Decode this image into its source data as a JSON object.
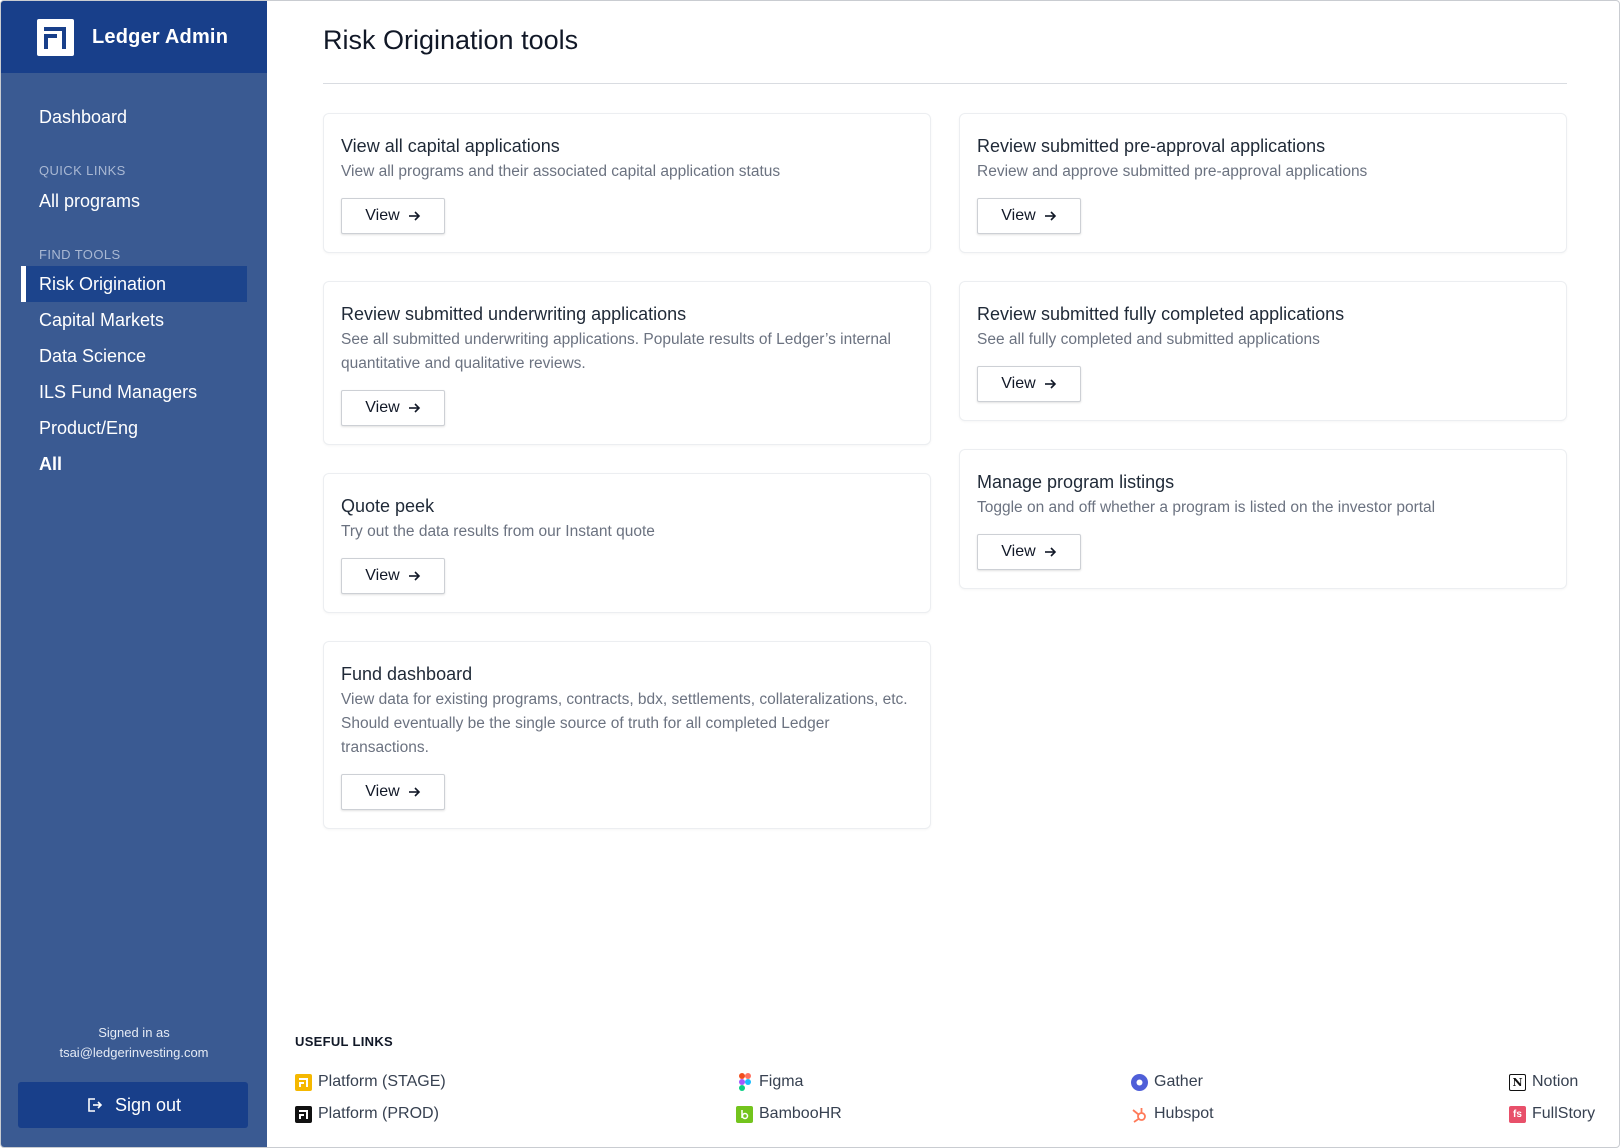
{
  "app": {
    "title": "Ledger Admin"
  },
  "sidebar": {
    "dashboard": "Dashboard",
    "quick_links_heading": "QUICK LINKS",
    "quick_links": [
      "All programs"
    ],
    "find_tools_heading": "FIND TOOLS",
    "tools": [
      "Risk Origination",
      "Capital Markets",
      "Data Science",
      "ILS Fund Managers",
      "Product/Eng",
      "All"
    ],
    "active_tool": "Risk Origination",
    "signed_in_label": "Signed in as",
    "signed_in_email": "tsai@ledgerinvesting.com",
    "sign_out": "Sign out"
  },
  "main": {
    "title": "Risk Origination tools",
    "view_label": "View",
    "cards": [
      {
        "title": "View all capital applications",
        "desc": "View all programs and their associated capital application status"
      },
      {
        "title": "Review submitted underwriting applications",
        "desc": "See all submitted underwriting applications. Populate results of Ledger’s internal quantitative and qualitative reviews."
      },
      {
        "title": "Quote peek",
        "desc": "Try out the data results from our Instant quote"
      },
      {
        "title": "Fund dashboard",
        "desc": "View data for existing programs, contracts, bdx, settlements, collateralizations, etc. Should eventually be the single source of truth for all completed Ledger transactions."
      },
      {
        "title": "Review submitted pre-approval applications",
        "desc": "Review and approve submitted pre-approval applications"
      },
      {
        "title": "Review submitted fully completed applications",
        "desc": "See all fully completed and submitted applications"
      },
      {
        "title": "Manage program listings",
        "desc": "Toggle on and off whether a program is listed on the investor portal"
      }
    ]
  },
  "useful_links": {
    "heading": "USEFUL LINKS",
    "items": [
      {
        "label": "Platform (STAGE)",
        "icon": "ledger-stage-icon",
        "color": "#f5b800"
      },
      {
        "label": "Platform (PROD)",
        "icon": "ledger-prod-icon",
        "color": "#111111"
      },
      {
        "label": "Figma",
        "icon": "figma-icon",
        "color": "#f24e1e"
      },
      {
        "label": "BambooHR",
        "icon": "bamboohr-icon",
        "color": "#73c41d"
      },
      {
        "label": "Gather",
        "icon": "gather-icon",
        "color": "#4f5fd8"
      },
      {
        "label": "Hubspot",
        "icon": "hubspot-icon",
        "color": "#ff7a59"
      },
      {
        "label": "Notion",
        "icon": "notion-icon",
        "color": "#111111"
      },
      {
        "label": "FullStory",
        "icon": "fullstory-icon",
        "color": "#e8506a"
      }
    ]
  },
  "colors": {
    "sidebar": "#3a5a92",
    "brand_bar": "#183f8a",
    "active_item": "#1c448c"
  }
}
